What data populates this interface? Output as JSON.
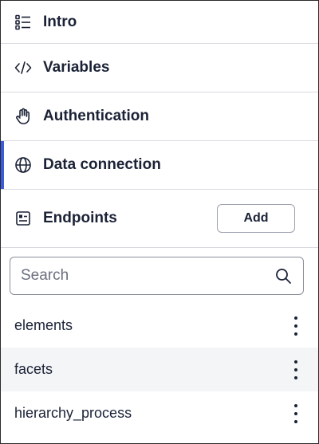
{
  "nav": {
    "items": [
      {
        "label": "Intro",
        "icon": "list-icon"
      },
      {
        "label": "Variables",
        "icon": "code-icon"
      },
      {
        "label": "Authentication",
        "icon": "hand-icon"
      },
      {
        "label": "Data connection",
        "icon": "globe-icon",
        "active": true
      }
    ]
  },
  "endpoints": {
    "title": "Endpoints",
    "icon": "layout-icon",
    "add_label": "Add"
  },
  "search": {
    "placeholder": "Search"
  },
  "list": {
    "items": [
      {
        "name": "elements"
      },
      {
        "name": "facets"
      },
      {
        "name": "hierarchy_process"
      }
    ]
  },
  "colors": {
    "accent": "#3b5bdb",
    "text": "#1b2236",
    "divider": "#d9dbe0",
    "row_alt": "#f4f5f7"
  }
}
